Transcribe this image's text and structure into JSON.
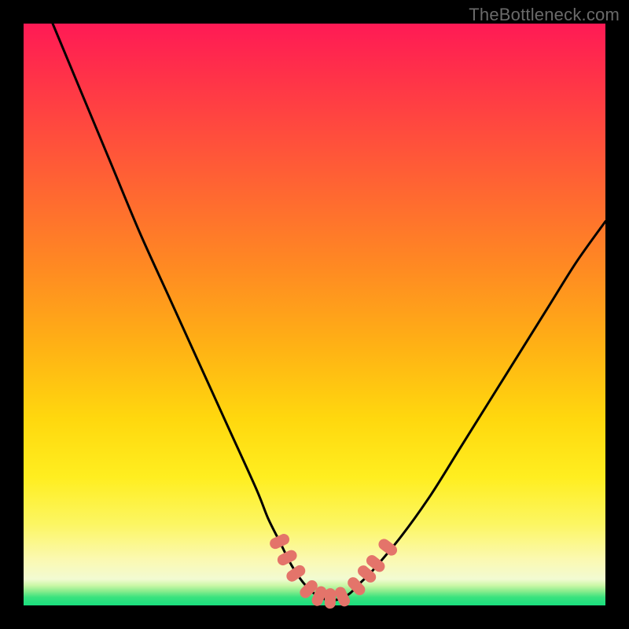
{
  "watermark": "TheBottleneck.com",
  "colors": {
    "frame": "#000000",
    "curve": "#000000",
    "marker_fill": "#e4746a",
    "marker_stroke": "#c95a52",
    "grad_top": "#ff1a55",
    "grad_bottom": "#19df7e"
  },
  "chart_data": {
    "type": "line",
    "title": "",
    "xlabel": "",
    "ylabel": "",
    "xlim": [
      0,
      100
    ],
    "ylim": [
      0,
      100
    ],
    "series": [
      {
        "name": "bottleneck-curve",
        "x": [
          5,
          10,
          15,
          20,
          25,
          30,
          35,
          40,
          42,
          44,
          46,
          48,
          50,
          52,
          54,
          56,
          58,
          60,
          65,
          70,
          75,
          80,
          85,
          90,
          95,
          100
        ],
        "y": [
          100,
          88,
          76,
          64,
          53,
          42,
          31,
          20,
          15,
          11,
          7,
          4,
          2,
          1,
          1,
          2,
          4,
          6,
          12,
          19,
          27,
          35,
          43,
          51,
          59,
          66
        ]
      }
    ],
    "markers": [
      {
        "x": 44.0,
        "y": 11.0
      },
      {
        "x": 45.3,
        "y": 8.2
      },
      {
        "x": 46.8,
        "y": 5.5
      },
      {
        "x": 49.0,
        "y": 2.8
      },
      {
        "x": 50.8,
        "y": 1.6
      },
      {
        "x": 52.7,
        "y": 1.2
      },
      {
        "x": 54.8,
        "y": 1.5
      },
      {
        "x": 57.2,
        "y": 3.3
      },
      {
        "x": 59.0,
        "y": 5.4
      },
      {
        "x": 60.5,
        "y": 7.2
      },
      {
        "x": 62.6,
        "y": 10.0
      }
    ],
    "annotations": []
  }
}
